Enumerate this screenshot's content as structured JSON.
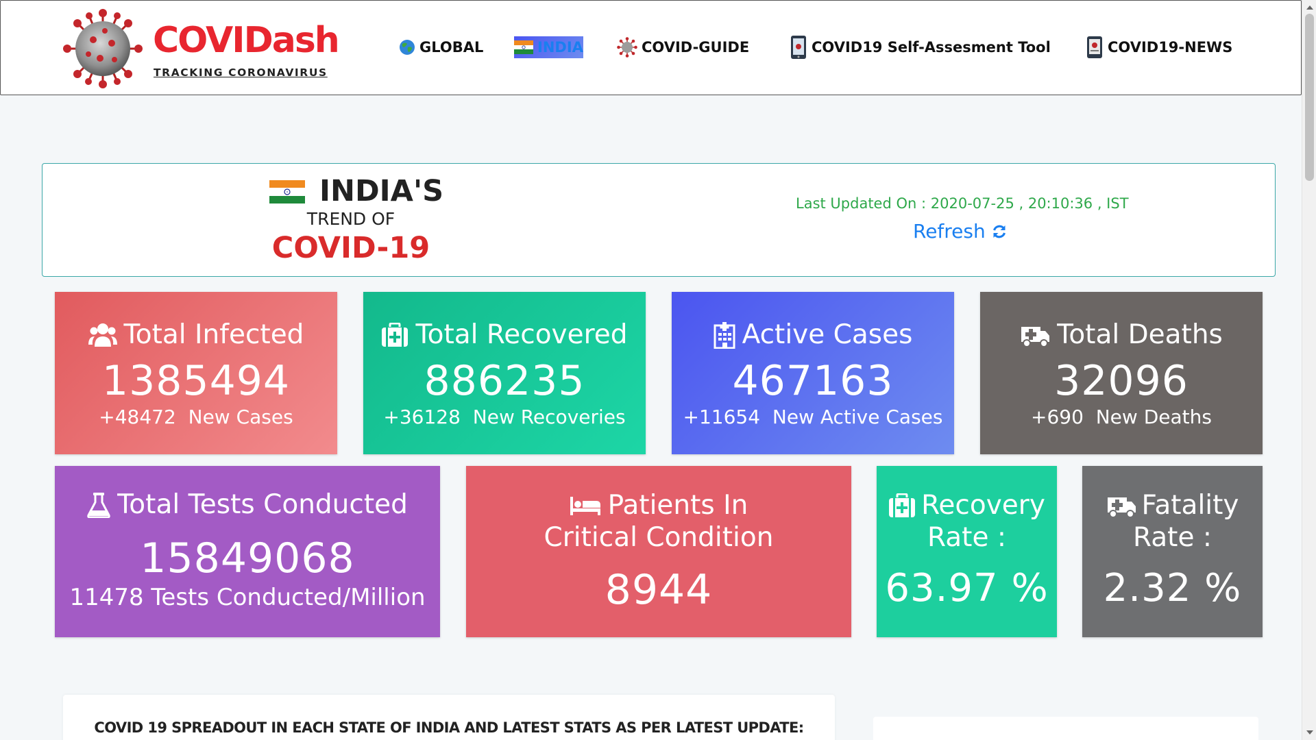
{
  "brand": {
    "name": "COVIDash",
    "tagline": "TRACKING CORONAVIRUS"
  },
  "nav": {
    "global": "GLOBAL",
    "india": "INDIA",
    "guide": "COVID-GUIDE",
    "self_assessment": "COVID19 Self-Assesment Tool",
    "news": "COVID19-NEWS",
    "active_item": "INDIA"
  },
  "header": {
    "title": "INDIA'S",
    "subtitle": "TREND OF",
    "disease": "COVID-19",
    "last_updated_label": "Last Updated On :",
    "last_updated_value": "2020-07-25 , 20:10:36 , IST",
    "refresh": "Refresh"
  },
  "stats": {
    "infected": {
      "title": "Total Infected",
      "value": "1385494",
      "delta": "+48472",
      "delta_label": "New Cases",
      "icon": "users-icon"
    },
    "recovered": {
      "title": "Total Recovered",
      "value": "886235",
      "delta": "+36128",
      "delta_label": "New Recoveries",
      "icon": "medkit-icon"
    },
    "active": {
      "title": "Active Cases",
      "value": "467163",
      "delta": "+11654",
      "delta_label": "New Active Cases",
      "icon": "hospital-icon"
    },
    "deaths": {
      "title": "Total Deaths",
      "value": "32096",
      "delta": "+690",
      "delta_label": "New Deaths",
      "icon": "ambulance-icon"
    },
    "tests": {
      "title": "Total Tests Conducted",
      "value": "15849068",
      "sub": "11478 Tests Conducted/Million",
      "icon": "flask-icon"
    },
    "critical": {
      "title_line1": "Patients In",
      "title_line2": "Critical Condition",
      "value": "8944",
      "icon": "bed-icon"
    },
    "recovery_rate": {
      "title_line1": "Recovery",
      "title_line2": "Rate :",
      "value": "63.97 %",
      "icon": "medkit-icon"
    },
    "fatality_rate": {
      "title_line1": "Fatality",
      "title_line2": "Rate :",
      "value": "2.32 %",
      "icon": "ambulance-icon"
    }
  },
  "state_section": {
    "heading": "COVID 19 SPREADOUT IN EACH STATE OF INDIA AND LATEST STATS AS PER LATEST UPDATE:"
  },
  "colors": {
    "brand_red": "#e8262f",
    "link_blue": "#1a7ff0",
    "updated_green": "#2ea84a",
    "infected": "#e15b5e",
    "recovered": "#13b98c",
    "active": "#4b55f0",
    "deaths": "#6b6664",
    "tests": "#a35bc5",
    "critical": "#e35f6a",
    "recovery_rate": "#1dcf9e",
    "fatality_rate": "#6e6f71"
  }
}
